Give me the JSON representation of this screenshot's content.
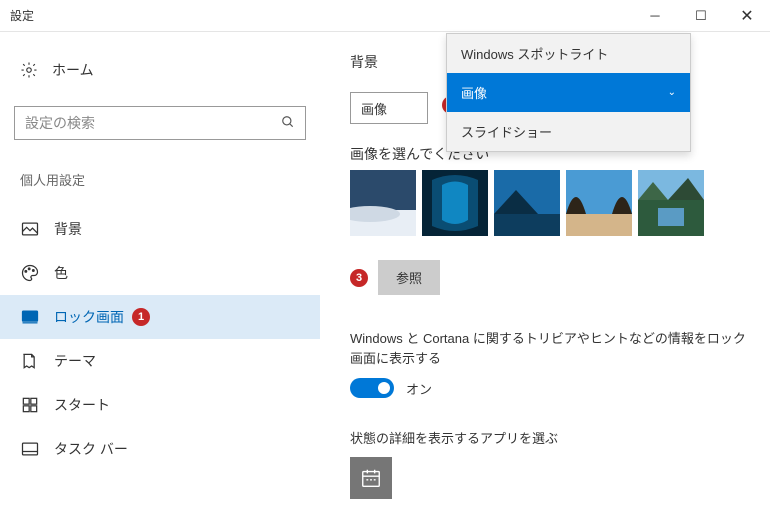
{
  "window": {
    "title": "設定"
  },
  "sidebar": {
    "home": "ホーム",
    "search_placeholder": "設定の検索",
    "section": "個人用設定",
    "items": [
      {
        "label": "背景"
      },
      {
        "label": "色"
      },
      {
        "label": "ロック画面"
      },
      {
        "label": "テーマ"
      },
      {
        "label": "スタート"
      },
      {
        "label": "タスク バー"
      }
    ]
  },
  "content": {
    "bg_section_label": "背景",
    "dropdown_selected": "画像",
    "dropdown_options": [
      "Windows スポットライト",
      "画像",
      "スライドショー"
    ],
    "select_image_label": "画像を選んでください",
    "browse_label": "参照",
    "trivia_text": "Windows と Cortana に関するトリビアやヒントなどの情報をロック画面に表示する",
    "toggle_on": "オン",
    "status_apps_label": "状態の詳細を表示するアプリを選ぶ"
  },
  "badges": {
    "b1": "1",
    "b2": "2",
    "b3": "3"
  }
}
